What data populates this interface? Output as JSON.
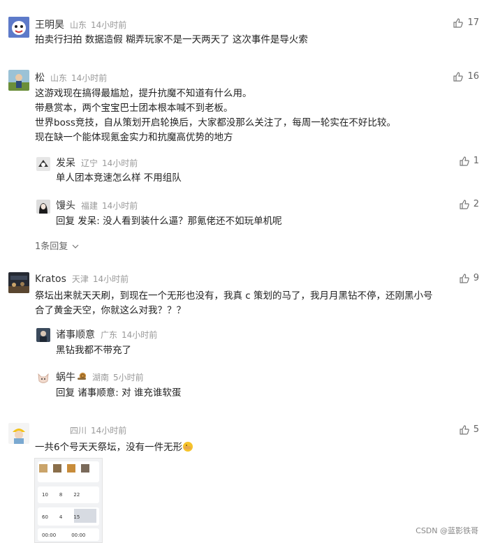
{
  "comments": [
    {
      "user": "王明昊",
      "location": "山东",
      "time": "14小时前",
      "likes": "17",
      "lines": [
        "拍卖行扫拍 数据造假 糊弄玩家不是一天两天了 这次事件是导火索"
      ]
    },
    {
      "user": "松",
      "location": "山东",
      "time": "14小时前",
      "likes": "16",
      "lines": [
        "这游戏现在搞得最尴尬，提升抗魔不知道有什么用。",
        "带悬赏本，两个宝宝巴士团本根本喊不到老板。",
        "世界boss竞技，自从策划开启轮换后，大家都没那么关注了，每周一轮实在不好比较。",
        "现在缺一个能体现氪金实力和抗魔高优势的地方"
      ],
      "replies": [
        {
          "user": "发呆",
          "location": "辽宁",
          "time": "14小时前",
          "likes": "1",
          "text": "单人团本竞速怎么样 不用组队"
        },
        {
          "user": "馒头",
          "location": "福建",
          "time": "14小时前",
          "likes": "2",
          "text": "回复 发呆: 没人看到装什么逼？那氪佬还不如玩单机呢"
        }
      ],
      "more_replies": "1条回复"
    },
    {
      "user": "Kratos",
      "location": "天津",
      "time": "14小时前",
      "likes": "9",
      "lines": [
        "祭坛出来就天天刷，到现在一个无形也没有，我真 c 策划的马了，我月月黑钻不停，还刚黑小号",
        "合了黄金天空，你就这么对我？？？"
      ],
      "replies": [
        {
          "user": "诸事顺意",
          "location": "广东",
          "time": "14小时前",
          "text": "黑钻我都不带充了"
        },
        {
          "user": "蜗牛",
          "location": "湖南",
          "time": "5小时前",
          "text": "回复 诸事顺意: 对 谁充谁软蛋"
        }
      ]
    },
    {
      "user": "",
      "location": "四川",
      "time": "14小时前",
      "likes": "5",
      "lines": [
        "一共6个号天天祭坛，没有一件无形"
      ],
      "thumb": {
        "stats1": [
          "10",
          "8",
          "22"
        ],
        "stats2": [
          "60",
          "4",
          "15"
        ],
        "times": [
          "00:00",
          "00:00"
        ]
      }
    }
  ],
  "watermark": "CSDN @蓝影铁哥"
}
